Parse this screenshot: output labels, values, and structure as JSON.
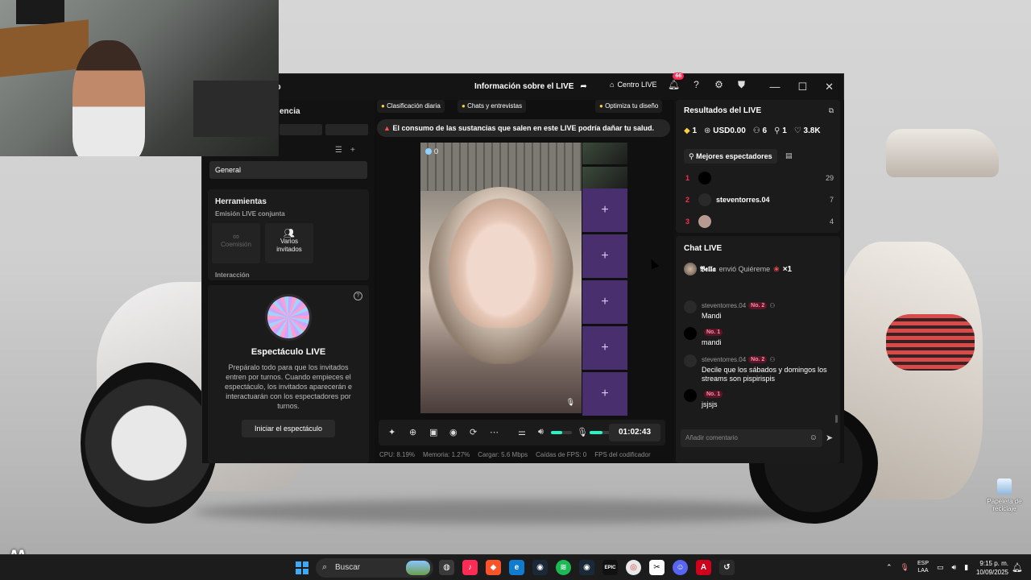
{
  "window": {
    "title_fragment": "io",
    "live_info": "Información sobre el LIVE",
    "live_center": "Centro LIVE",
    "notif_count": "66"
  },
  "left": {
    "section_fragment": "encia",
    "general": "General",
    "tools_title": "Herramientas",
    "tools_sub": "Emisión LIVE conjunta",
    "cohost": "Coemisión",
    "multi_guests": "Varios invitados",
    "interaction": "Interacción",
    "show_title": "Espectáculo LIVE",
    "show_desc": "Prepáralo todo para que los invitados entren por turnos. Cuando empieces el espectáculo, los invitados aparecerán e interactuarán con los espectadores por turnos.",
    "show_button": "Iniciar el espectáculo"
  },
  "center": {
    "chips": [
      "Clasificación diaria",
      "Chats y entrevistas",
      "Optimiza tu diseño"
    ],
    "warning": "El consumo de las sustancias que salen en este LIVE podría dañar tu salud.",
    "viewers": "0",
    "timer": "01:02:43",
    "mic_level": 0.6,
    "speaker_level": 0.55,
    "stats": [
      "CPU: 8.19%",
      "Memoria: 1.27%",
      "Cargar: 5.6 Mbps",
      "Caídas de FPS: 0",
      "FPS del codificador"
    ]
  },
  "right": {
    "results_title": "Resultados del LIVE",
    "metrics": {
      "gems": "1",
      "usd": "USD0.00",
      "viewers": "6",
      "followers": "1",
      "likes": "3.8K"
    },
    "top_viewers_btn": "Mejores espectadores",
    "top": [
      {
        "rank": "1",
        "name": "",
        "score": "29"
      },
      {
        "rank": "2",
        "name": "steventorres.04",
        "score": "7"
      },
      {
        "rank": "3",
        "name": "",
        "score": "4"
      }
    ],
    "chat_title": "Chat LIVE",
    "gift": {
      "user": "𝕭𝖊𝖑𝖑𝖆",
      "action": "envió Quiéreme",
      "count": "×1"
    },
    "messages": [
      {
        "user": "steventorres.04",
        "level": "No. 2",
        "text": "Mandi"
      },
      {
        "user": "",
        "level": "No. 1",
        "text": "mandi"
      },
      {
        "user": "steventorres.04",
        "level": "No. 2",
        "text": "Decile que los sábados y domingos los streams son pispirispis"
      },
      {
        "user": "",
        "level": "No. 1",
        "text": "jsjsjs"
      }
    ],
    "comment_placeholder": "Añadir comentario"
  },
  "desktop": {
    "recycle_bin": "Papelera de reciclaje"
  },
  "taskbar": {
    "search": "Buscar",
    "lang1": "ESP",
    "lang2": "LAA",
    "time": "9:15 p. m.",
    "date": "10/09/2025"
  }
}
